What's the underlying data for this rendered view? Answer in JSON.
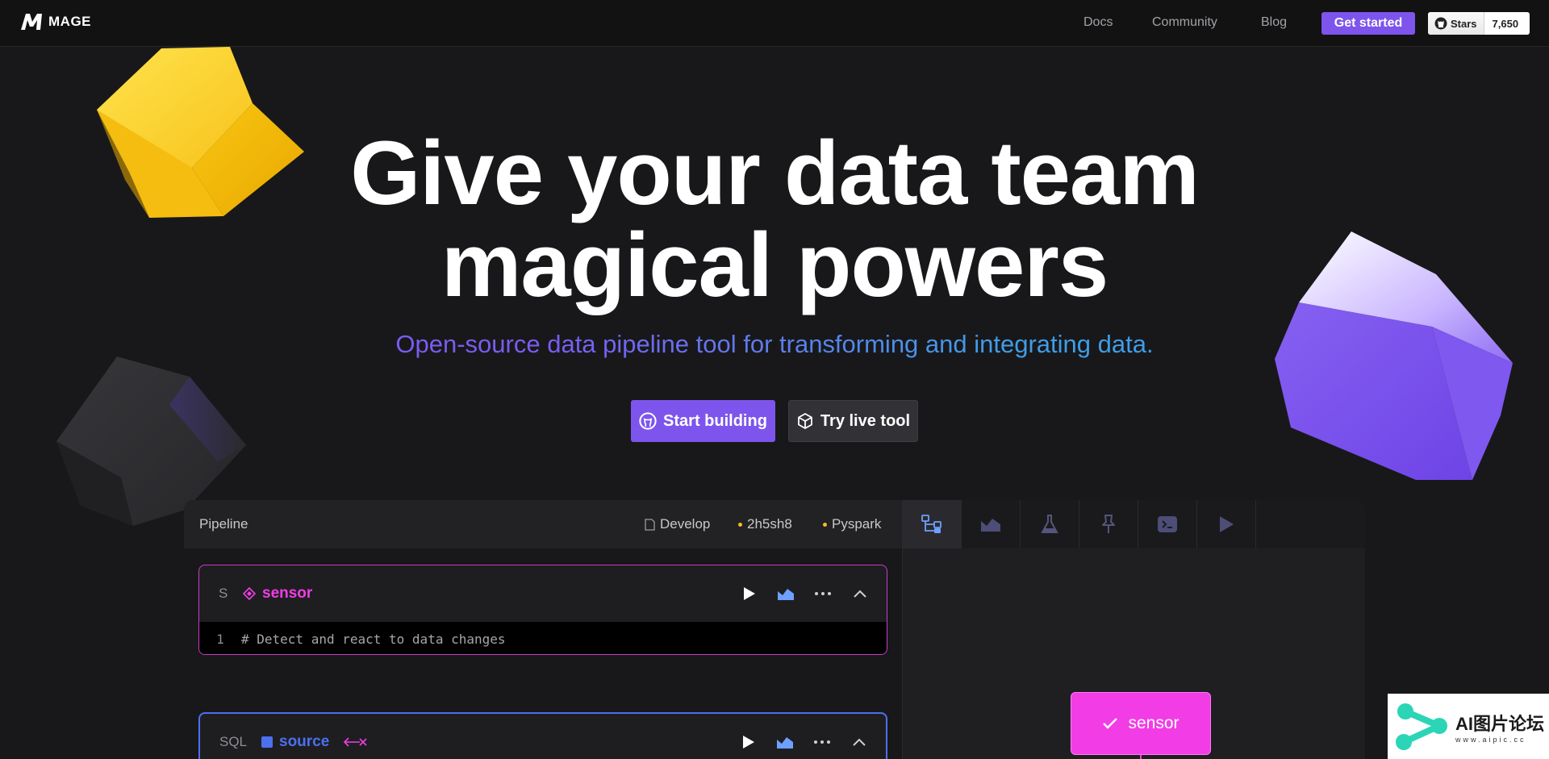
{
  "nav": {
    "brand": "MAGE",
    "links": [
      "Docs",
      "Community",
      "Blog"
    ],
    "cta": "Get started",
    "stars_label": "Stars",
    "stars_count": "7,650"
  },
  "hero": {
    "headline_line1": "Give your data team",
    "headline_line2": "magical powers",
    "tagline": "Open-source data pipeline tool for transforming and integrating data.",
    "cta_primary": "Start building",
    "cta_secondary": "Try live tool"
  },
  "app": {
    "pipeline_title": "Pipeline",
    "mode": "Develop",
    "pipeline_id": "2h5sh8",
    "engine": "Pyspark",
    "toolbar_icons": [
      "tree-icon",
      "chart-icon",
      "flask-icon",
      "pin-icon",
      "terminal-icon",
      "play-icon"
    ],
    "blocks": [
      {
        "type": "S",
        "name": "sensor",
        "color": "#f23de6",
        "code_line": "1",
        "code": "# Detect and react to data changes"
      },
      {
        "type": "SQL",
        "name": "source",
        "color": "#4b70f0"
      }
    ],
    "graph_node": "sensor"
  },
  "colors": {
    "accent": "#7d55ec",
    "sensor": "#f23de6",
    "source": "#4b70f0",
    "background": "#18181a"
  },
  "watermark": {
    "title": "AI图片论坛",
    "sub": "www.aipic.cc"
  }
}
